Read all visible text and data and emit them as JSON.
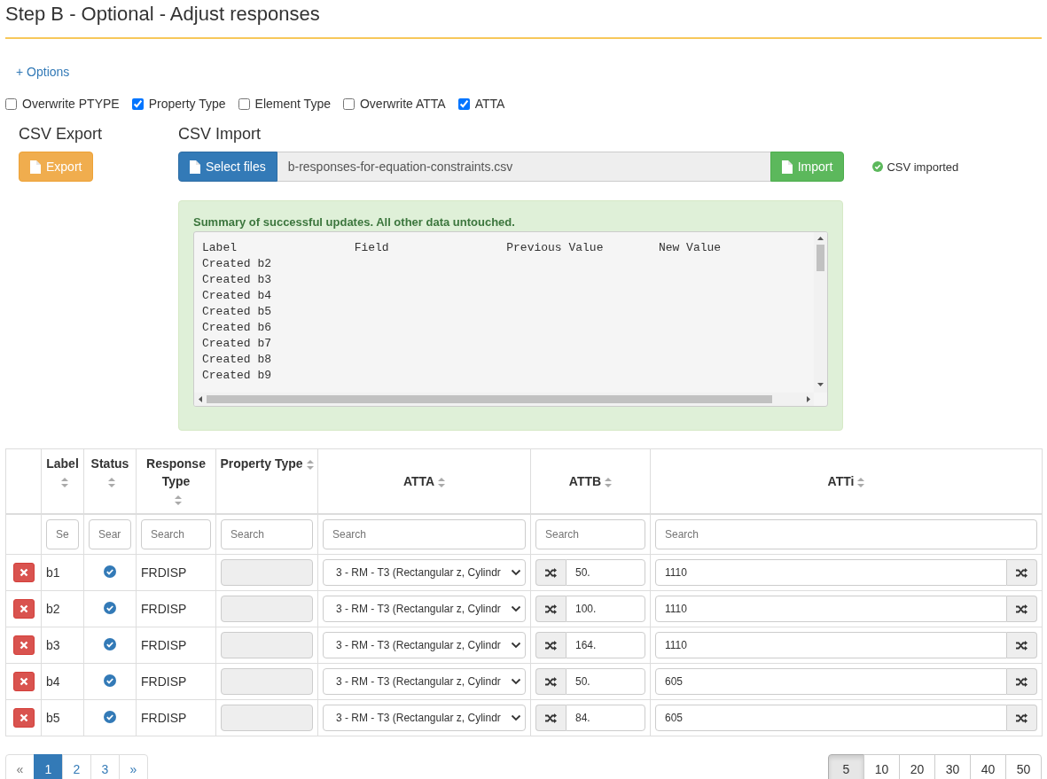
{
  "title": "Step B - Optional - Adjust responses",
  "options_link": "+ Options",
  "checkboxes": [
    {
      "label": "Overwrite PTYPE",
      "checked": false
    },
    {
      "label": "Property Type",
      "checked": true
    },
    {
      "label": "Element Type",
      "checked": false
    },
    {
      "label": "Overwrite ATTA",
      "checked": false
    },
    {
      "label": "ATTA",
      "checked": true
    }
  ],
  "export": {
    "heading": "CSV Export",
    "button": "Export"
  },
  "import": {
    "heading": "CSV Import",
    "select_button": "Select files",
    "file_name": "b-responses-for-equation-constraints.csv",
    "import_button": "Import",
    "status": "CSV imported"
  },
  "summary": {
    "title": "Summary of successful updates. All other data untouched.",
    "lines": [
      "Label                 Field                 Previous Value        New Value",
      "Created b2",
      "Created b3",
      "Created b4",
      "Created b5",
      "Created b6",
      "Created b7",
      "Created b8",
      "Created b9"
    ]
  },
  "table": {
    "columns": [
      {
        "label": "Label",
        "sortable": true
      },
      {
        "label": "Status",
        "sortable": true
      },
      {
        "label": "Response Type",
        "sortable": true
      },
      {
        "label": "Property Type",
        "sortable": true
      },
      {
        "label": "ATTA",
        "sortable": true
      },
      {
        "label": "ATTB",
        "sortable": true
      },
      {
        "label": "ATTi",
        "sortable": true
      }
    ],
    "filters": [
      {
        "placeholder": "Se"
      },
      {
        "placeholder": "Sear"
      },
      {
        "placeholder": "Search"
      },
      {
        "placeholder": "Search"
      },
      {
        "placeholder": "Search"
      },
      {
        "placeholder": "Search"
      },
      {
        "placeholder": "Search"
      }
    ],
    "rows": [
      {
        "label": "b1",
        "ok": true,
        "response_type": "FRDISP",
        "atta": "3 - RM - T3 (Rectangular z, Cylindr",
        "attb": "50.",
        "atti": "1110"
      },
      {
        "label": "b2",
        "ok": true,
        "response_type": "FRDISP",
        "atta": "3 - RM - T3 (Rectangular z, Cylindr",
        "attb": "100.",
        "atti": "1110"
      },
      {
        "label": "b3",
        "ok": true,
        "response_type": "FRDISP",
        "atta": "3 - RM - T3 (Rectangular z, Cylindr",
        "attb": "164.",
        "atti": "1110"
      },
      {
        "label": "b4",
        "ok": true,
        "response_type": "FRDISP",
        "atta": "3 - RM - T3 (Rectangular z, Cylindr",
        "attb": "50.",
        "atti": "605"
      },
      {
        "label": "b5",
        "ok": true,
        "response_type": "FRDISP",
        "atta": "3 - RM - T3 (Rectangular z, Cylindr",
        "attb": "84.",
        "atti": "605"
      }
    ]
  },
  "pagination": {
    "prev": "«",
    "next": "»",
    "pages": [
      {
        "label": "1",
        "selected": true
      },
      {
        "label": "2",
        "selected": false
      },
      {
        "label": "3",
        "selected": false
      }
    ]
  },
  "page_sizes": [
    {
      "label": "5",
      "selected": true
    },
    {
      "label": "10",
      "selected": false
    },
    {
      "label": "20",
      "selected": false
    },
    {
      "label": "30",
      "selected": false
    },
    {
      "label": "40",
      "selected": false
    },
    {
      "label": "50",
      "selected": false
    }
  ]
}
